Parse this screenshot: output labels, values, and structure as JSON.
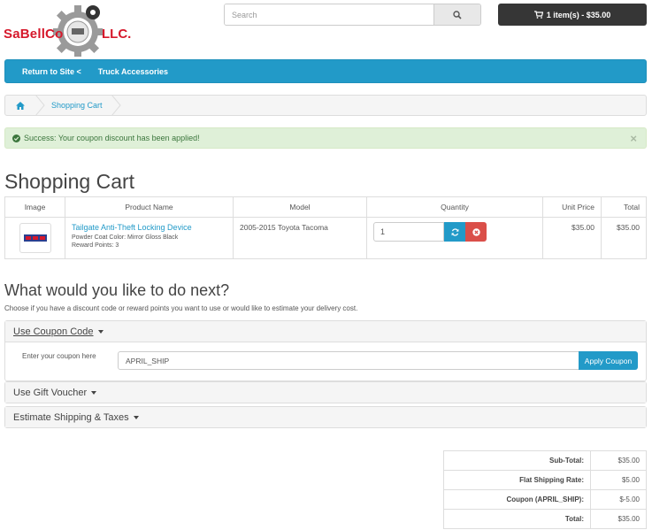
{
  "logo": {
    "part1": "SaBellCo",
    "part2": "LLC."
  },
  "search": {
    "placeholder": "Search",
    "icon": "search-icon"
  },
  "cart_button": {
    "label": "1 item(s) - $35.00",
    "icon": "shopping-cart-icon"
  },
  "menu": {
    "items": [
      {
        "label": "Return to Site <"
      },
      {
        "label": "Truck Accessories"
      }
    ]
  },
  "breadcrumb": {
    "home_icon": "home-icon",
    "items": [
      {
        "label": "Shopping Cart"
      }
    ]
  },
  "alert": {
    "message": "Success: Your coupon discount has been applied!",
    "close": "×",
    "icon": "check-circle-icon"
  },
  "page_title": "Shopping Cart",
  "cart_table": {
    "headers": [
      "Image",
      "Product Name",
      "Model",
      "Quantity",
      "Unit Price",
      "Total"
    ],
    "rows": [
      {
        "product_name": "Tailgate Anti-Theft Locking Device",
        "option": "Powder Coat Color: Mirror Gloss Black",
        "reward": "Reward Points: 3",
        "model": "2005-2015 Toyota Tacoma",
        "quantity": "1",
        "unit_price": "$35.00",
        "total": "$35.00",
        "update_icon": "refresh-icon",
        "remove_icon": "remove-icon"
      }
    ]
  },
  "next": {
    "title": "What would you like to do next?",
    "subtitle": "Choose if you have a discount code or reward points you want to use or would like to estimate your delivery cost."
  },
  "panels": {
    "coupon": {
      "title": "Use Coupon Code",
      "label": "Enter your coupon here",
      "value": "APRIL_SHIP",
      "button": "Apply Coupon"
    },
    "voucher": {
      "title": "Use Gift Voucher"
    },
    "shipping": {
      "title": "Estimate Shipping & Taxes"
    }
  },
  "totals": [
    {
      "label": "Sub-Total:",
      "value": "$35.00"
    },
    {
      "label": "Flat Shipping Rate:",
      "value": "$5.00"
    },
    {
      "label": "Coupon (APRIL_SHIP):",
      "value": "$-5.00"
    },
    {
      "label": "Total:",
      "value": "$35.00"
    }
  ],
  "colors": {
    "accent": "#229ac8",
    "brand": "#d6182b",
    "success_bg": "#dff0d8",
    "danger": "#da4f49",
    "dark": "#363636"
  }
}
